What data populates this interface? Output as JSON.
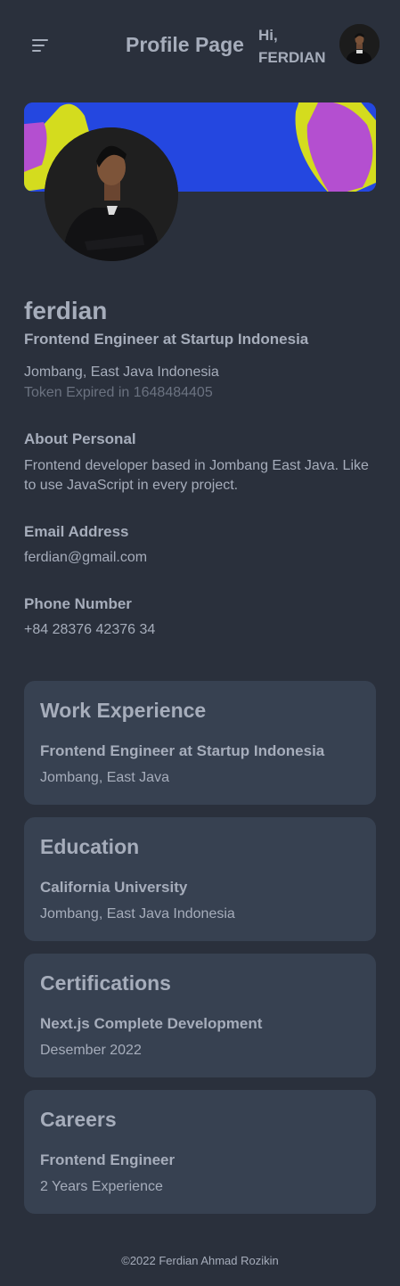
{
  "header": {
    "title": "Profile Page",
    "greeting": "Hi, FERDIAN",
    "menu_icon": "hamburger-menu-icon",
    "avatar_icon": "user-avatar"
  },
  "profile": {
    "name": "ferdian",
    "headline": "Frontend Engineer at Startup Indonesia",
    "location": "Jombang, East Java Indonesia",
    "token_text": "Token Expired in 1648484405"
  },
  "about": {
    "label": "About Personal",
    "value": "Frontend developer based in Jombang East Java. Like to use JavaScript in every project."
  },
  "email": {
    "label": "Email Address",
    "value": "ferdian@gmail.com"
  },
  "phone": {
    "label": "Phone Number",
    "value": "+84 28376 42376 34"
  },
  "cards": [
    {
      "title": "Work Experience",
      "subtitle": "Frontend Engineer at Startup Indonesia",
      "detail": "Jombang, East Java"
    },
    {
      "title": "Education",
      "subtitle": "California University",
      "detail": "Jombang, East Java Indonesia"
    },
    {
      "title": "Certifications",
      "subtitle": "Next.js Complete Development",
      "detail": "Desember 2022"
    },
    {
      "title": "Careers",
      "subtitle": "Frontend Engineer",
      "detail": "2 Years Experience"
    }
  ],
  "footer": {
    "text": "©2022 Ferdian Ahmad Rozikin"
  },
  "colors": {
    "background": "#2a303c",
    "card": "#374151",
    "banner_blue": "#2447e0",
    "banner_yellow": "#d4dc1e",
    "banner_purple": "#b44fd0",
    "text": "#a6adbb",
    "muted": "#6b7280"
  }
}
